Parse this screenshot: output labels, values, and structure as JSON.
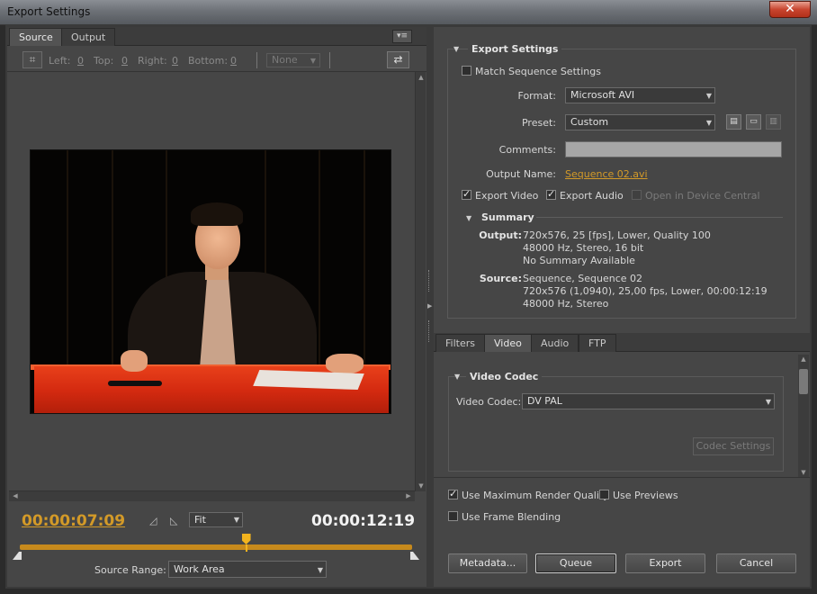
{
  "window": {
    "title": "Export Settings",
    "close_glyph": "✕"
  },
  "left_tabs": [
    {
      "label": "Source",
      "active": true
    },
    {
      "label": "Output",
      "active": false
    }
  ],
  "crop": {
    "left_label": "Left:",
    "left_value": "0",
    "top_label": "Top:",
    "top_value": "0",
    "right_label": "Right:",
    "right_value": "0",
    "bottom_label": "Bottom:",
    "bottom_value": "0",
    "aspect_selected": "None"
  },
  "timecode": {
    "current": "00:00:07:09",
    "duration": "00:00:12:19",
    "playhead_fraction": 0.577
  },
  "zoom": {
    "selected": "Fit"
  },
  "source_range": {
    "label": "Source Range:",
    "selected": "Work Area"
  },
  "export_settings": {
    "header": "Export Settings",
    "match_sequence_label": "Match Sequence Settings",
    "match_sequence_checked": false,
    "format_label": "Format:",
    "format_value": "Microsoft AVI",
    "preset_label": "Preset:",
    "preset_value": "Custom",
    "comments_label": "Comments:",
    "comments_value": "",
    "output_name_label": "Output Name:",
    "output_name_value": "Sequence 02.avi",
    "export_video_label": "Export Video",
    "export_video_checked": true,
    "export_audio_label": "Export Audio",
    "export_audio_checked": true,
    "device_central_label": "Open in Device Central",
    "device_central_checked": false
  },
  "summary": {
    "header": "Summary",
    "output_key": "Output:",
    "output_lines": [
      "720x576, 25 [fps], Lower, Quality 100",
      "48000 Hz, Stereo, 16 bit",
      "No Summary Available"
    ],
    "source_key": "Source:",
    "source_lines": [
      "Sequence, Sequence 02",
      "720x576 (1,0940), 25,00 fps, Lower, 00:00:12:19",
      "48000 Hz, Stereo"
    ]
  },
  "right_tabs": [
    {
      "label": "Filters",
      "active": false
    },
    {
      "label": "Video",
      "active": true
    },
    {
      "label": "Audio",
      "active": false
    },
    {
      "label": "FTP",
      "active": false
    }
  ],
  "video_codec": {
    "header": "Video Codec",
    "codec_label": "Video Codec:",
    "codec_value": "DV PAL",
    "codec_settings_button": "Codec Settings"
  },
  "options": {
    "max_render_label": "Use Maximum Render Quality",
    "max_render_checked": true,
    "use_previews_label": "Use Previews",
    "use_previews_checked": false,
    "frame_blending_label": "Use Frame Blending",
    "frame_blending_checked": false
  },
  "buttons": {
    "metadata": "Metadata...",
    "queue": "Queue",
    "export": "Export",
    "cancel": "Cancel"
  },
  "icons": {
    "crop": "crop-icon",
    "swap": "swap-icon",
    "panel_menu": "panel-menu-icon",
    "save_preset": "save-icon",
    "import_preset": "folder-icon",
    "delete_preset": "trash-icon",
    "set_in": "set-in-point-icon",
    "set_out": "set-out-point-icon"
  },
  "colors": {
    "timecode_accent": "#d39a28",
    "link": "#d39a28",
    "panel_bg": "#464646"
  }
}
